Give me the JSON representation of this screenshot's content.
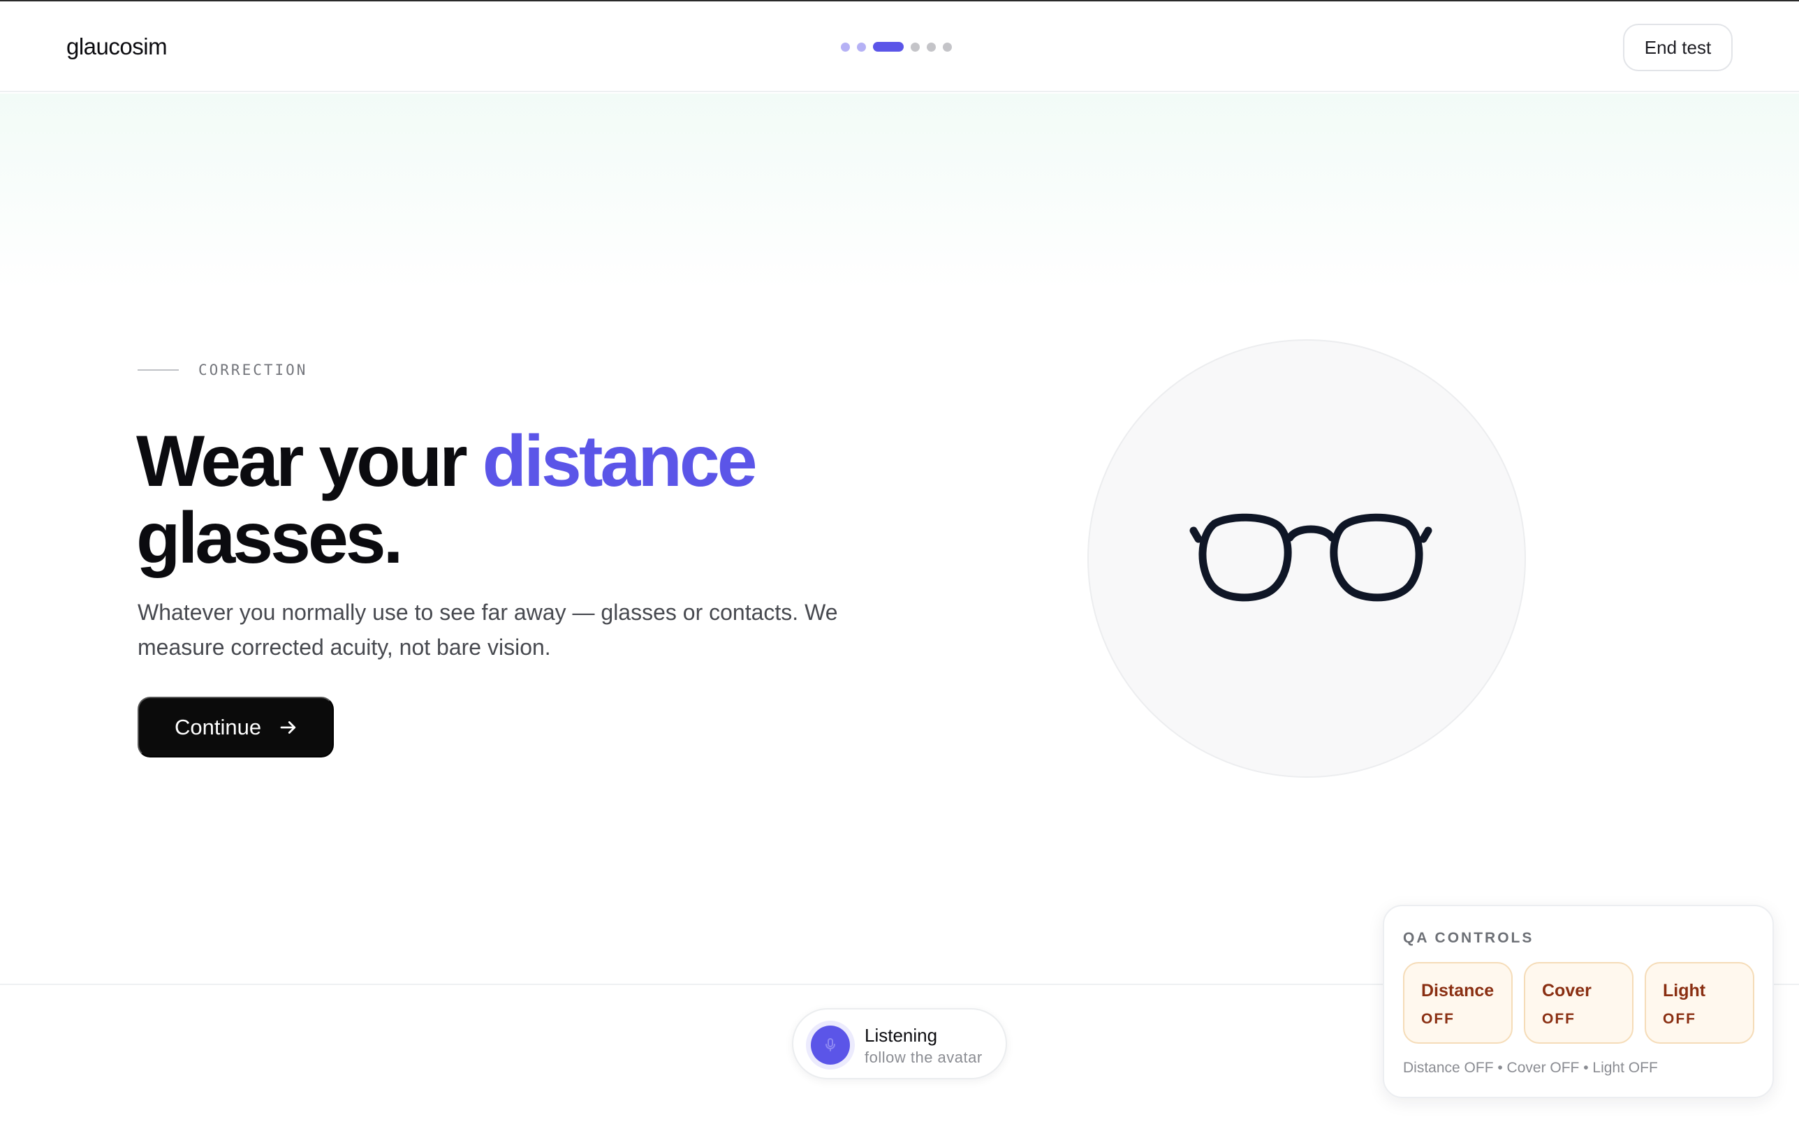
{
  "app": {
    "brand": "glaucosim"
  },
  "progress": {
    "total_steps": 6,
    "current_step": 3
  },
  "header": {
    "end_test_label": "End test"
  },
  "hero": {
    "eyebrow": "CORRECTION",
    "headline_before": "Wear your ",
    "headline_accent": "distance",
    "headline_after": "glasses.",
    "lede": "Whatever you normally use to see far away — glasses or contacts. We measure corrected acuity, not bare vision.",
    "continue_label": "Continue",
    "illustration_icon": "glasses-icon"
  },
  "listening": {
    "title": "Listening",
    "subtitle": "follow the avatar",
    "icon": "microphone-icon"
  },
  "qa": {
    "title": "QA CONTROLS",
    "toggles": [
      {
        "label": "Distance",
        "state": "OFF"
      },
      {
        "label": "Cover",
        "state": "OFF"
      },
      {
        "label": "Light",
        "state": "OFF"
      }
    ],
    "summary": "Distance OFF • Cover OFF • Light OFF"
  },
  "colors": {
    "accent": "#5b55e8",
    "accent_light": "#b5b1f5",
    "qa_text": "#8a2f12",
    "qa_bg": "#fff8ee",
    "status_online": "#3ccf4e"
  }
}
